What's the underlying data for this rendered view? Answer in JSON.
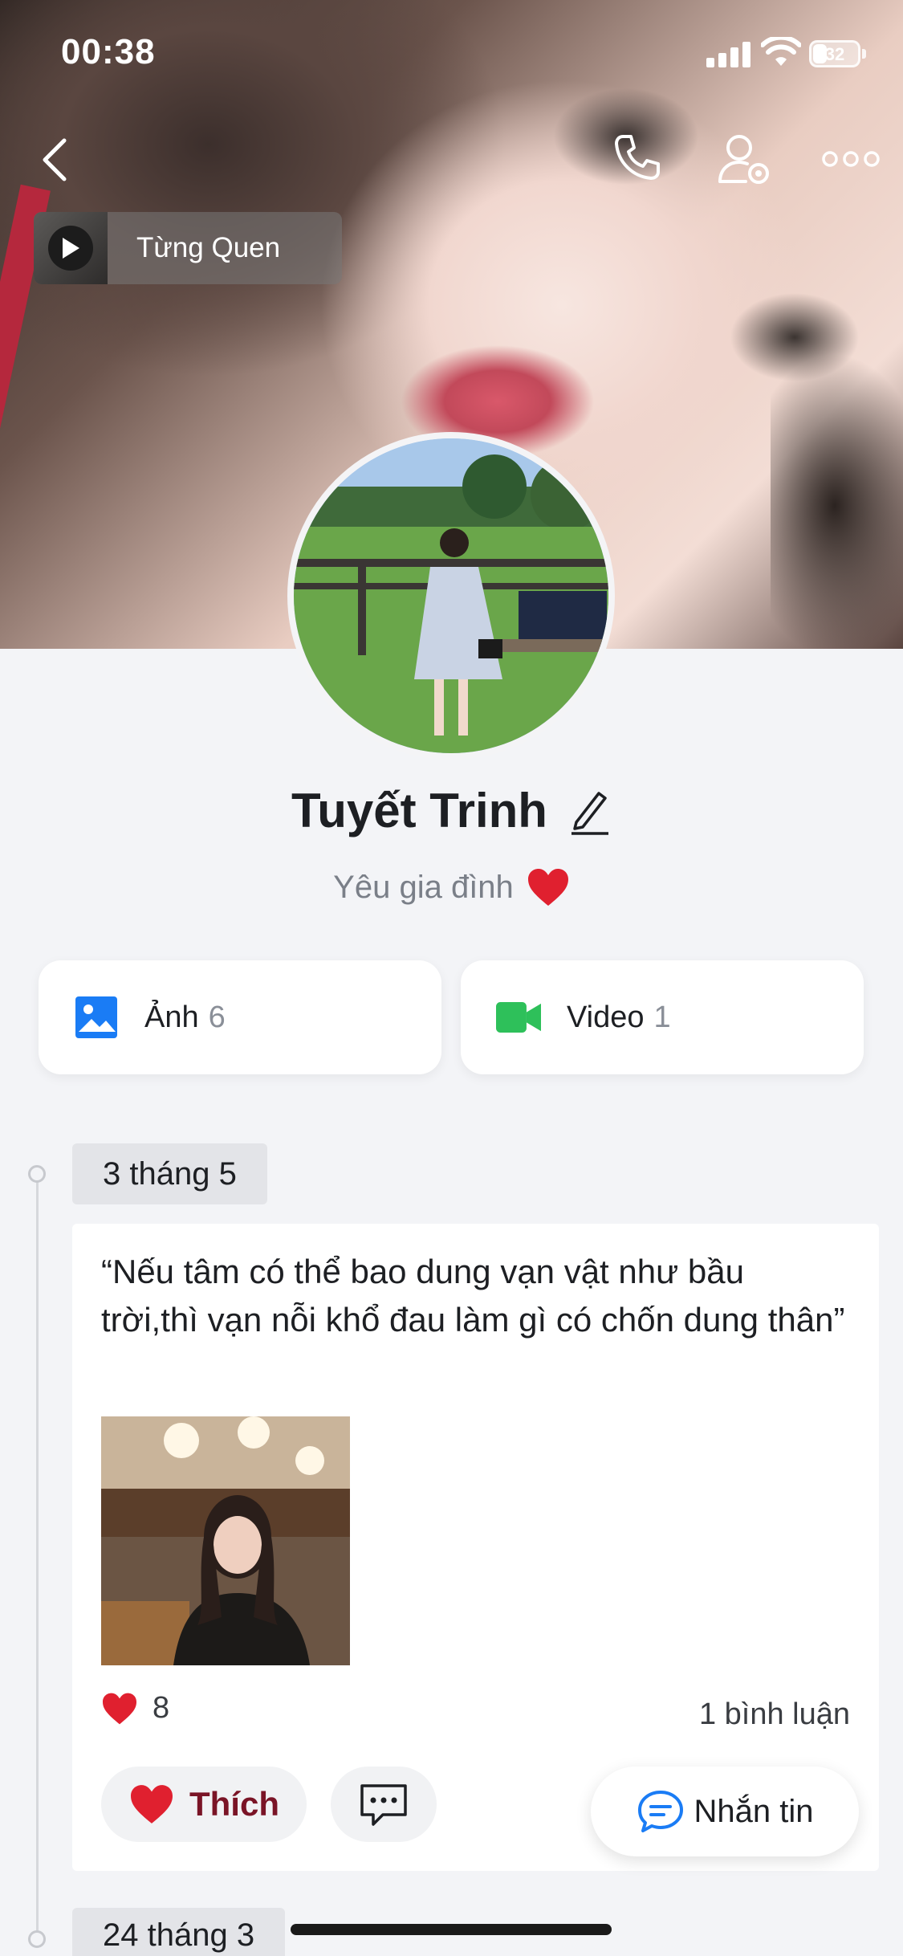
{
  "status_bar": {
    "time": "00:38",
    "battery": "32"
  },
  "cover": {
    "music_title": "Từng Quen"
  },
  "profile": {
    "name": "Tuyết Trinh",
    "bio": "Yêu gia đình"
  },
  "media": [
    {
      "label": "Ảnh",
      "count": "6",
      "icon": "image-icon",
      "color": "#1a7cf5"
    },
    {
      "label": "Video",
      "count": "1",
      "icon": "video-camera-icon",
      "color": "#2ec05a"
    }
  ],
  "timeline": {
    "posts": [
      {
        "date": "3 tháng 5",
        "text": "“Nếu tâm có thể bao dung vạn vật như bầu trời,thì vạn nỗi khổ đau làm gì có chốn dung thân”",
        "likes": "8",
        "comments": "1 bình luận",
        "like_label": "Thích"
      }
    ],
    "next_date": "24 tháng 3"
  },
  "actions": {
    "message_label": "Nhắn tin"
  },
  "colors": {
    "accent_blue": "#1a7cf5",
    "heart_red": "#e0202f",
    "like_text": "#7a1426"
  }
}
